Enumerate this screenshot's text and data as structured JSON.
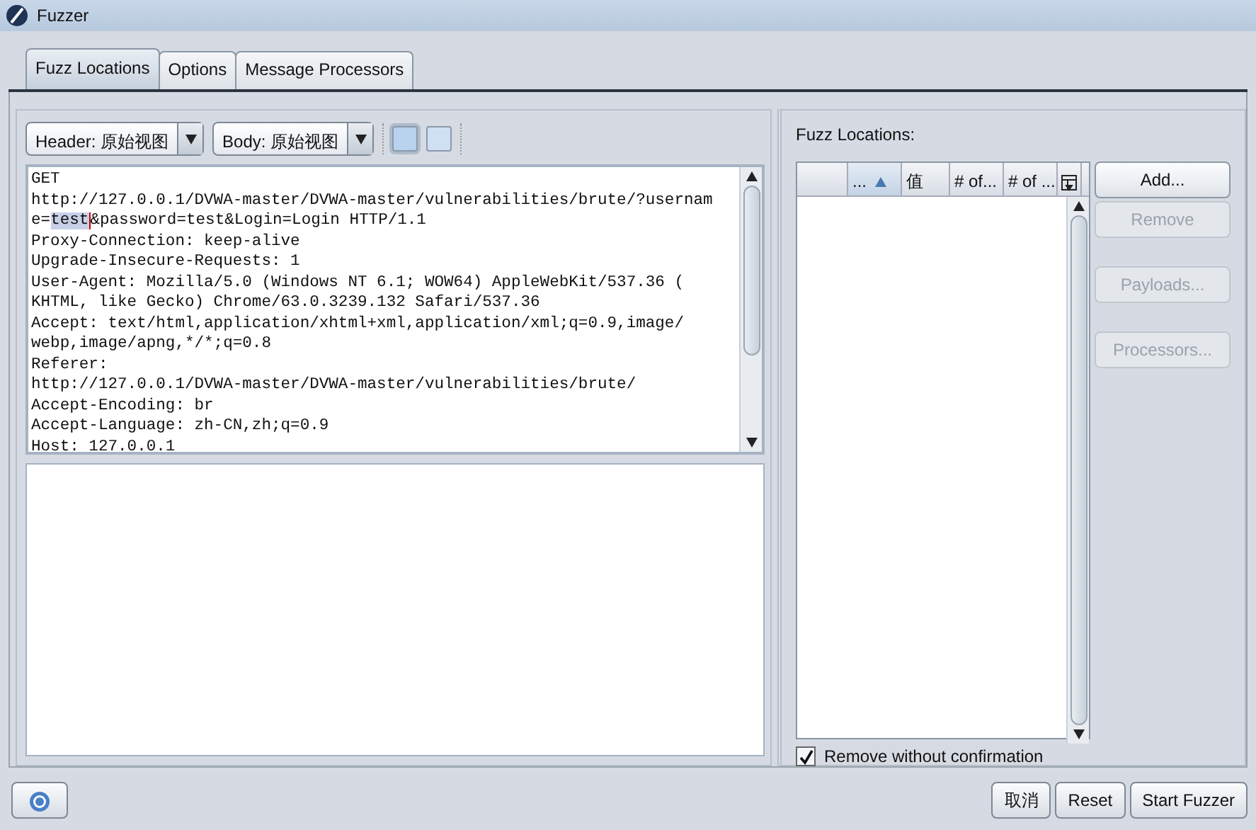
{
  "window": {
    "title": "Fuzzer"
  },
  "tabs": [
    {
      "label": "Fuzz Locations",
      "selected": true
    },
    {
      "label": "Options",
      "selected": false
    },
    {
      "label": "Message Processors",
      "selected": false
    }
  ],
  "view_selectors": [
    {
      "label": "Header: 原始视图"
    },
    {
      "label": "Body: 原始视图"
    }
  ],
  "layout_toggles": [
    {
      "selected": true
    },
    {
      "selected": false
    }
  ],
  "request_lines": [
    [
      {
        "text": "GET",
        "highlighted": false
      }
    ],
    [
      {
        "text": "http://127.0.0.1/DVWA-master/DVWA-master/vulnerabilities/brute/?usernam",
        "highlighted": false
      }
    ],
    [
      {
        "text": "e=",
        "highlighted": false
      },
      {
        "text": "test",
        "highlighted": true
      },
      {
        "text": "&password=test&Login=Login HTTP/1.1",
        "highlighted": false
      }
    ],
    [
      {
        "text": "Proxy-Connection: keep-alive",
        "highlighted": false
      }
    ],
    [
      {
        "text": "Upgrade-Insecure-Requests: 1",
        "highlighted": false
      }
    ],
    [
      {
        "text": "User-Agent: Mozilla/5.0 (Windows NT 6.1; WOW64) AppleWebKit/537.36 (",
        "highlighted": false
      }
    ],
    [
      {
        "text": "KHTML, like Gecko) Chrome/63.0.3239.132 Safari/537.36",
        "highlighted": false
      }
    ],
    [
      {
        "text": "Accept: text/html,application/xhtml+xml,application/xml;q=0.9,image/",
        "highlighted": false
      }
    ],
    [
      {
        "text": "webp,image/apng,*/*;q=0.8",
        "highlighted": false
      }
    ],
    [
      {
        "text": "Referer:",
        "highlighted": false
      }
    ],
    [
      {
        "text": "http://127.0.0.1/DVWA-master/DVWA-master/vulnerabilities/brute/",
        "highlighted": false
      }
    ],
    [
      {
        "text": "Accept-Encoding: br",
        "highlighted": false
      }
    ],
    [
      {
        "text": "Accept-Language: zh-CN,zh;q=0.9",
        "highlighted": false
      }
    ],
    [
      {
        "text": "Host: 127.0.0.1",
        "highlighted": false
      }
    ]
  ],
  "fuzz_locations": {
    "label": "Fuzz Locations:",
    "columns": [
      {
        "sorted": false
      },
      {
        "label": "...",
        "sorted": true
      },
      {
        "label": "值",
        "sorted": false
      },
      {
        "label": "# of...",
        "sorted": false
      },
      {
        "label": "# of ...",
        "sorted": false
      }
    ],
    "buttons": [
      {
        "label": "Add...",
        "disabled": false
      },
      {
        "label": "Remove",
        "disabled": true
      },
      {
        "label": "Payloads...",
        "disabled": true
      },
      {
        "label": "Processors...",
        "disabled": true
      }
    ],
    "remove_without_confirmation": {
      "label": "Remove without confirmation",
      "checked": true
    }
  },
  "footer_buttons": [
    "取消",
    "Reset",
    "Start Fuzzer"
  ]
}
